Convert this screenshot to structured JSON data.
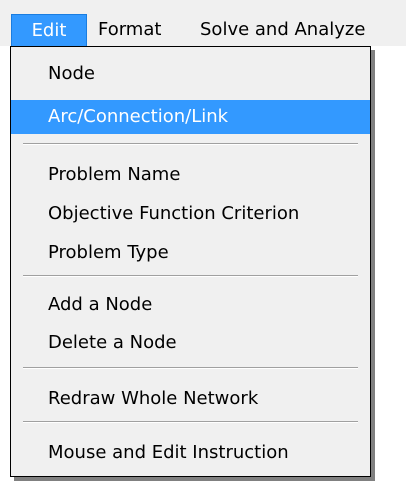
{
  "menubar": {
    "items": [
      {
        "label": "Edit",
        "active": true
      },
      {
        "label": "Format"
      },
      {
        "label": "Solve and Analyze"
      }
    ]
  },
  "edit_menu": {
    "items": [
      {
        "label": "Node"
      },
      {
        "label": "Arc/Connection/Link",
        "highlighted": true
      },
      {
        "label": "Problem Name"
      },
      {
        "label": "Objective Function Criterion"
      },
      {
        "label": "Problem Type"
      },
      {
        "label": "Add a Node"
      },
      {
        "label": "Delete a Node"
      },
      {
        "label": "Redraw Whole Network"
      },
      {
        "label": "Mouse and Edit Instruction"
      }
    ]
  },
  "colors": {
    "highlight": "#3399ff",
    "menu_background": "#f0f0f0",
    "separator": "#a0a0a0"
  }
}
